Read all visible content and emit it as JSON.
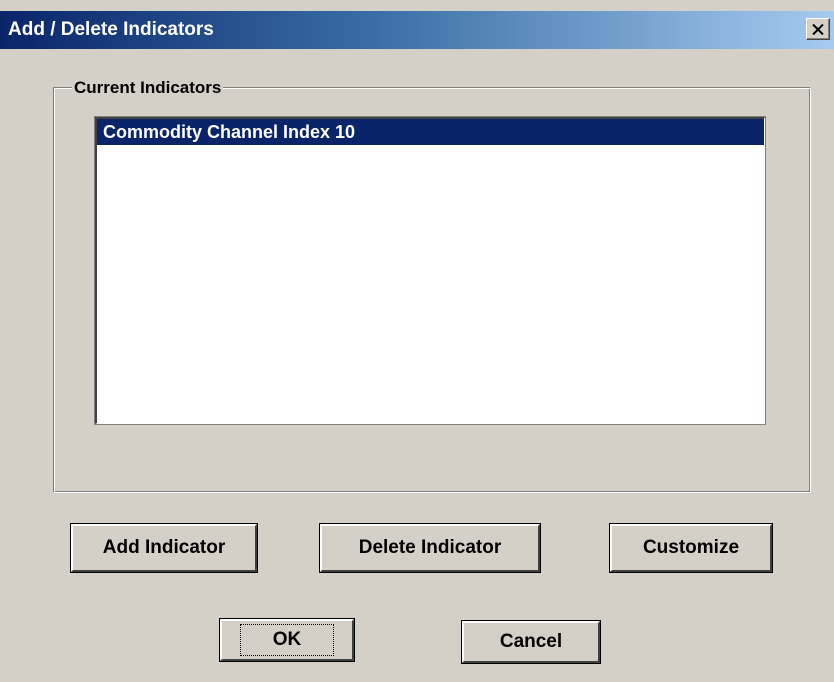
{
  "window": {
    "title": "Add / Delete Indicators",
    "close_label": "Close"
  },
  "group": {
    "label": "Current Indicators"
  },
  "indicators": {
    "items": [
      {
        "label": "Commodity Channel Index 10",
        "selected": true
      }
    ]
  },
  "buttons": {
    "add": "Add Indicator",
    "delete": "Delete Indicator",
    "customize": "Customize",
    "ok": "OK",
    "cancel": "Cancel"
  },
  "colors": {
    "face": "#d4d0c8",
    "title_start": "#0a246a",
    "title_end": "#a6caf0",
    "selection": "#0a246a"
  },
  "icons": {
    "close": "close-icon"
  }
}
